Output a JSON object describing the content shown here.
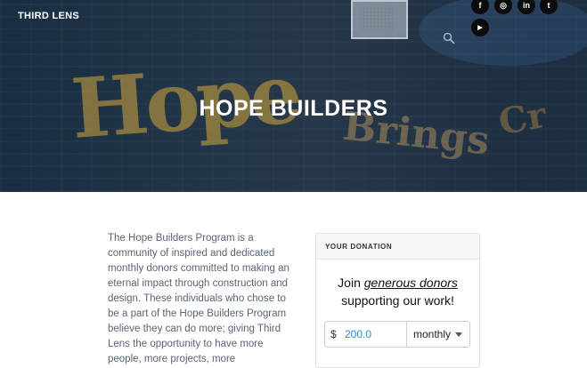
{
  "header": {
    "brand": "THIRD LENS",
    "social": [
      {
        "name": "facebook",
        "glyph": "f"
      },
      {
        "name": "instagram",
        "glyph": "◎"
      },
      {
        "name": "linkedin",
        "glyph": "in"
      },
      {
        "name": "twitter",
        "glyph": "t"
      },
      {
        "name": "youtube",
        "glyph": "▶"
      }
    ]
  },
  "hero": {
    "title": "HOPE BUILDERS",
    "graffiti": {
      "left": "Hope",
      "center": "Brings",
      "right": "Cr"
    }
  },
  "body": {
    "text": "The Hope Builders Program is a community of inspired and dedicated monthly donors committed to making an eternal impact through construction and design. These individuals who chose to be a part of the Hope Builders Program believe they can do more; giving Third Lens the opportunity to have more people, more projects, more"
  },
  "donation": {
    "header": "YOUR DONATION",
    "headline_prefix": "Join ",
    "headline_emph": "generous donors",
    "headline_suffix": "supporting our work!",
    "currency": "$",
    "amount": "200.0",
    "frequency": "monthly"
  },
  "colors": {
    "accent": "#2a8ad8",
    "hero_overlay": "#0a162a"
  }
}
